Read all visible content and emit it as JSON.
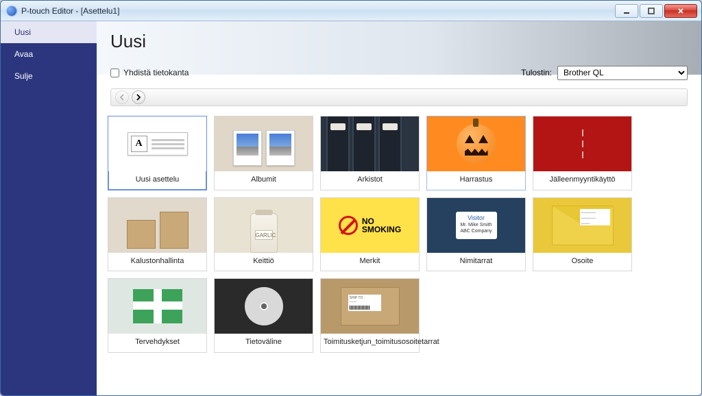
{
  "titlebar": {
    "app_name": "P-touch Editor",
    "doc_name": "[Asettelu1]"
  },
  "sidebar": {
    "items": [
      {
        "id": "new",
        "label": "Uusi",
        "active": true
      },
      {
        "id": "open",
        "label": "Avaa",
        "active": false
      },
      {
        "id": "close",
        "label": "Sulje",
        "active": false
      }
    ]
  },
  "page_heading": "Uusi",
  "options": {
    "connect_db_label": "Yhdistä tietokanta",
    "connect_db_checked": false
  },
  "printer": {
    "label": "Tulostin:",
    "selected": "Brother QL"
  },
  "templates": [
    {
      "id": "new-layout",
      "label": "Uusi asettelu",
      "thumb": "th-new",
      "selected": true
    },
    {
      "id": "albums",
      "label": "Albumit",
      "thumb": "th-album"
    },
    {
      "id": "archives",
      "label": "Arkistot",
      "thumb": "th-archive"
    },
    {
      "id": "hobby",
      "label": "Harrastus",
      "thumb": "th-hobby",
      "hover": true
    },
    {
      "id": "retail",
      "label": "Jälleenmyyntikäyttö",
      "thumb": "th-retail"
    },
    {
      "id": "inventory",
      "label": "Kalustonhallinta",
      "thumb": "th-inventory"
    },
    {
      "id": "kitchen",
      "label": "Keittiö",
      "thumb": "th-kitchen"
    },
    {
      "id": "signs",
      "label": "Merkit",
      "thumb": "th-sign"
    },
    {
      "id": "badges",
      "label": "Nimitarrat",
      "thumb": "th-badge"
    },
    {
      "id": "address",
      "label": "Osoite",
      "thumb": "th-address"
    },
    {
      "id": "greetings",
      "label": "Tervehdykset",
      "thumb": "th-greeting"
    },
    {
      "id": "media",
      "label": "Tietoväline",
      "thumb": "th-media"
    },
    {
      "id": "shipping",
      "label": "Toimitusketjun_toimitusosoitetarrat",
      "thumb": "th-ship"
    }
  ],
  "strings": {
    "no_smoking_line1": "NO",
    "no_smoking_line2": "SMOKING",
    "visitor_badge_title": "Visitor",
    "jar_label": "GARLIC"
  }
}
